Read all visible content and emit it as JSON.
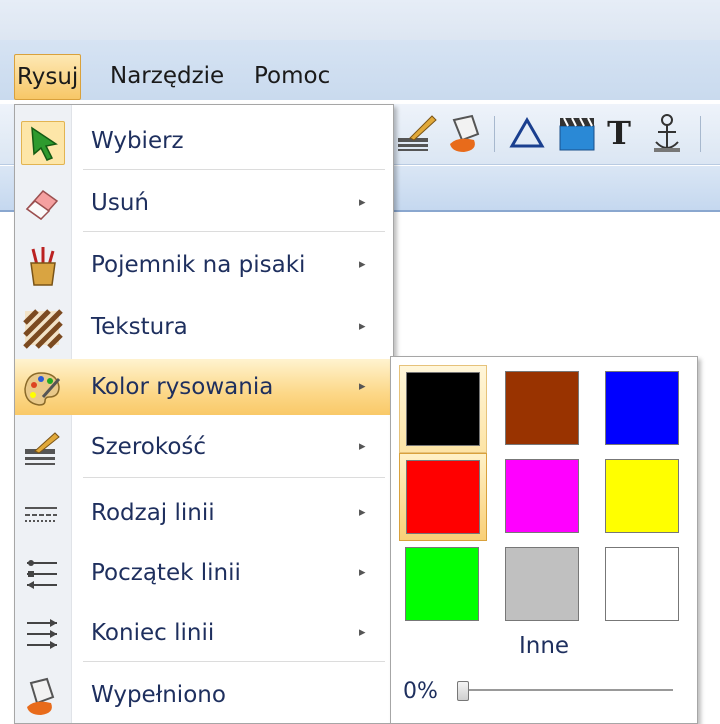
{
  "menubar": {
    "items": [
      {
        "label": "Rysuj",
        "active": true
      },
      {
        "label": "Narzędzie",
        "active": false
      },
      {
        "label": "Pomoc",
        "active": false
      }
    ]
  },
  "toolbar": {
    "icons": [
      "brush-width-icon",
      "paint-bucket-icon",
      "triangle-icon",
      "clapperboard-icon",
      "text-icon",
      "anchor-icon"
    ],
    "text_tool_glyph": "T"
  },
  "dropdown": {
    "items": [
      {
        "label": "Wybierz",
        "icon": "cursor-arrow-icon",
        "submenu": false,
        "selected": true
      },
      {
        "label": "Usuń",
        "icon": "eraser-icon",
        "submenu": true
      },
      {
        "label": "Pojemnik na pisaki",
        "icon": "pencil-cup-icon",
        "submenu": true
      },
      {
        "label": "Tekstura",
        "icon": "texture-icon",
        "submenu": true
      },
      {
        "label": "Kolor rysowania",
        "icon": "palette-icon",
        "submenu": true,
        "highlighted": true
      },
      {
        "label": "Szerokość",
        "icon": "line-width-icon",
        "submenu": true
      },
      {
        "label": "Rodzaj linii",
        "icon": "line-style-icon",
        "submenu": true
      },
      {
        "label": "Początek linii",
        "icon": "line-start-icon",
        "submenu": true
      },
      {
        "label": "Koniec linii",
        "icon": "line-end-icon",
        "submenu": true
      },
      {
        "label": "Wypełniono",
        "icon": "fill-bucket-icon",
        "submenu": false
      }
    ],
    "arrow_glyph": "▸"
  },
  "color_submenu": {
    "colors": [
      "#000000",
      "#993300",
      "#0000ff",
      "#ff0000",
      "#ff00ff",
      "#ffff00",
      "#00ff00",
      "#c0c0c0",
      "#ffffff"
    ],
    "color_names": [
      "black",
      "brown",
      "blue",
      "red",
      "magenta",
      "yellow",
      "green",
      "gray",
      "white"
    ],
    "selected_index": 3,
    "hover_index": 0,
    "more_label": "Inne",
    "opacity_label": "0%",
    "opacity_value": 0
  }
}
